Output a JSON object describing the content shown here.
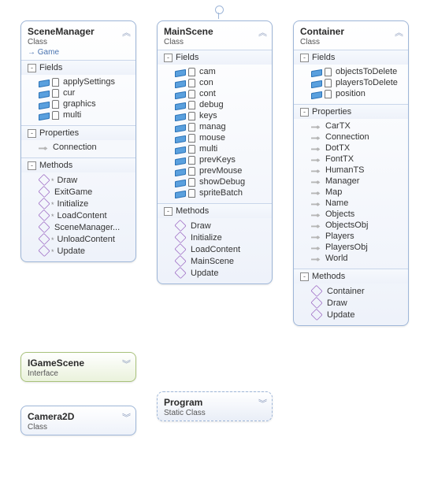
{
  "sceneManager": {
    "title": "SceneManager",
    "stereotype": "Class",
    "base": "Game",
    "sections": {
      "fields": {
        "label": "Fields",
        "items": [
          "applySettings",
          "cur",
          "graphics",
          "multi"
        ]
      },
      "properties": {
        "label": "Properties",
        "items": [
          "Connection"
        ]
      },
      "methods": {
        "label": "Methods",
        "items": [
          "Draw",
          "ExitGame",
          "Initialize",
          "LoadContent",
          "SceneManager...",
          "UnloadContent",
          "Update"
        ]
      }
    }
  },
  "mainScene": {
    "title": "MainScene",
    "stereotype": "Class",
    "sections": {
      "fields": {
        "label": "Fields",
        "items": [
          "cam",
          "con",
          "cont",
          "debug",
          "keys",
          "manag",
          "mouse",
          "multi",
          "prevKeys",
          "prevMouse",
          "showDebug",
          "spriteBatch"
        ]
      },
      "methods": {
        "label": "Methods",
        "items": [
          "Draw",
          "Initialize",
          "LoadContent",
          "MainScene",
          "Update"
        ]
      }
    }
  },
  "container": {
    "title": "Container",
    "stereotype": "Class",
    "sections": {
      "fields": {
        "label": "Fields",
        "items": [
          "objectsToDelete",
          "playersToDelete",
          "position"
        ]
      },
      "properties": {
        "label": "Properties",
        "items": [
          "CarTX",
          "Connection",
          "DotTX",
          "FontTX",
          "HumanTS",
          "Manager",
          "Map",
          "Name",
          "Objects",
          "ObjectsObj",
          "Players",
          "PlayersObj",
          "World"
        ]
      },
      "methods": {
        "label": "Methods",
        "items": [
          "Container",
          "Draw",
          "Update"
        ]
      }
    }
  },
  "igameScene": {
    "title": "IGameScene",
    "stereotype": "Interface"
  },
  "camera2d": {
    "title": "Camera2D",
    "stereotype": "Class"
  },
  "program": {
    "title": "Program",
    "stereotype": "Static Class"
  }
}
